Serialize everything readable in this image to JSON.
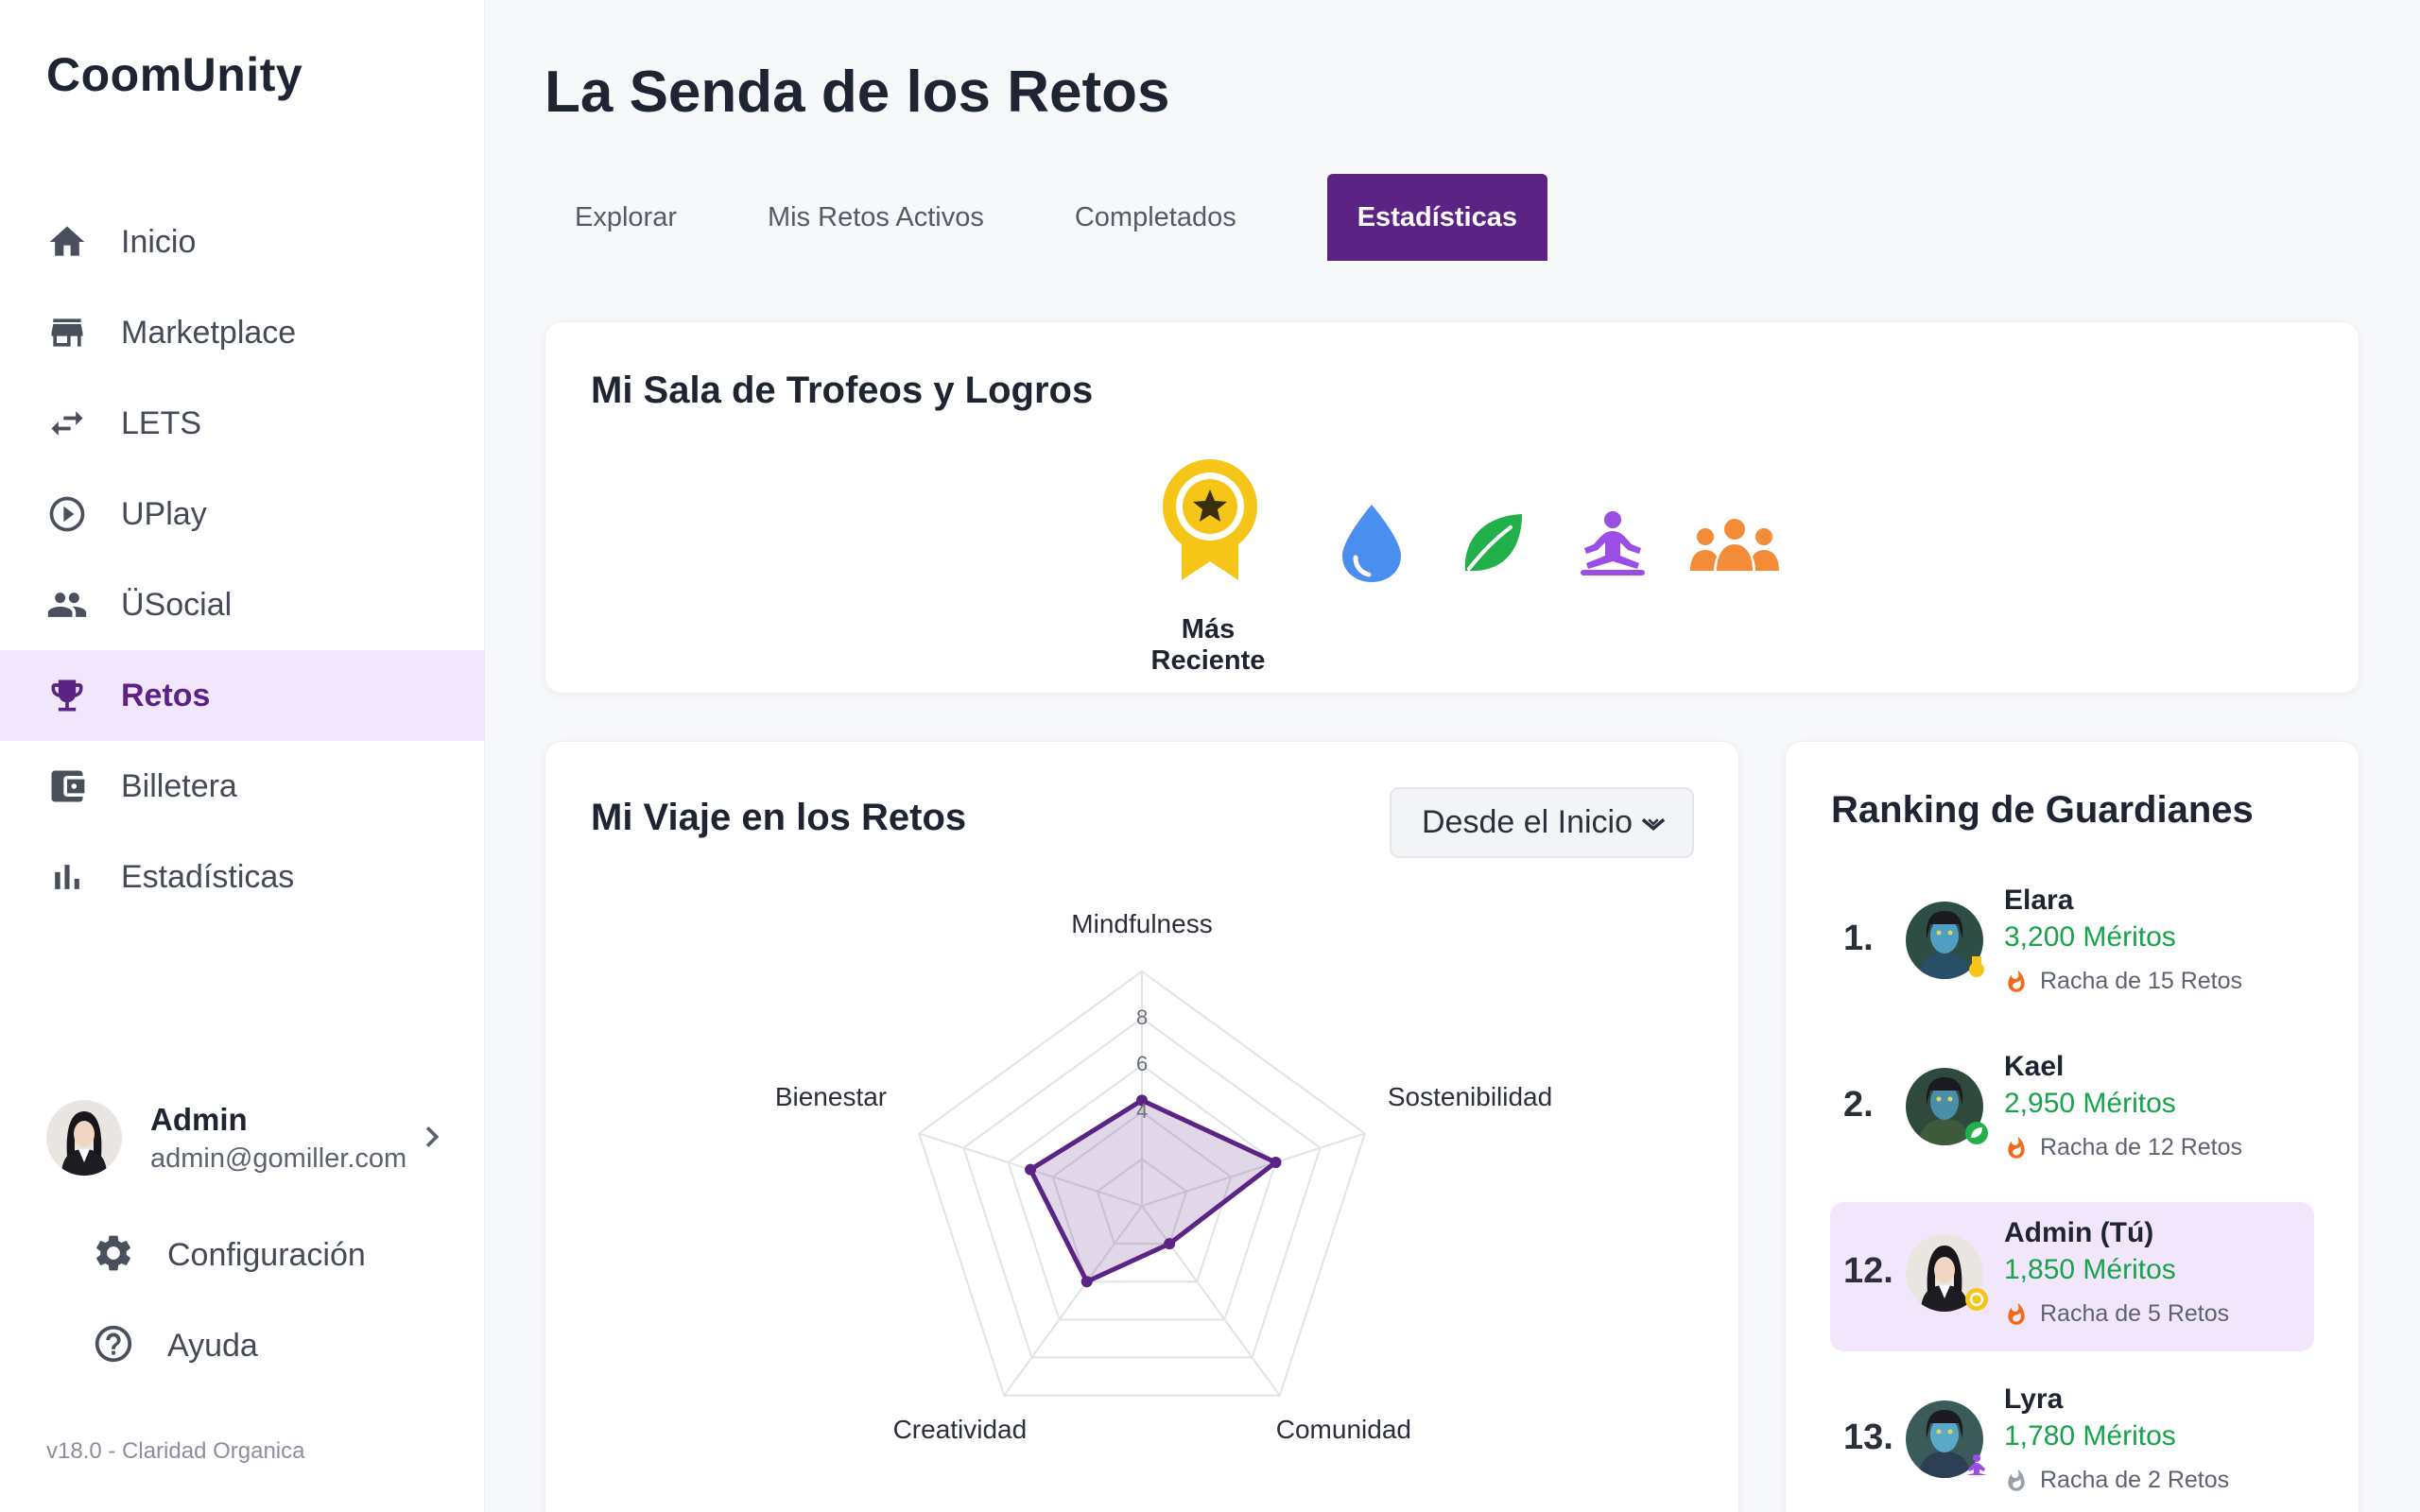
{
  "app": {
    "brand": "CoomUnity",
    "version": "v18.0 - Claridad Organica"
  },
  "sidebar": {
    "items": [
      {
        "label": "Inicio",
        "icon": "home-icon"
      },
      {
        "label": "Marketplace",
        "icon": "store-icon"
      },
      {
        "label": "LETS",
        "icon": "swap-arrows-icon"
      },
      {
        "label": "UPlay",
        "icon": "play-circle-icon"
      },
      {
        "label": "ÜSocial",
        "icon": "people-icon"
      },
      {
        "label": "Retos",
        "icon": "trophy-icon",
        "active": true
      },
      {
        "label": "Billetera",
        "icon": "wallet-icon"
      },
      {
        "label": "Estadísticas",
        "icon": "bar-chart-icon"
      }
    ],
    "profile": {
      "name": "Admin",
      "email": "admin@gomiller.com"
    },
    "settings_label": "Configuración",
    "help_label": "Ayuda"
  },
  "page": {
    "title": "La Senda de los Retos"
  },
  "tabs": [
    {
      "label": "Explorar"
    },
    {
      "label": "Mis Retos Activos"
    },
    {
      "label": "Completados"
    },
    {
      "label": "Estadísticas",
      "active": true
    }
  ],
  "trophies": {
    "title": "Mi Sala de Trofeos y Logros",
    "recent_label": "Más Reciente",
    "items": [
      {
        "icon": "medal-star-icon",
        "color": "#f5c518"
      },
      {
        "icon": "water-drop-icon",
        "color": "#4a8ef0"
      },
      {
        "icon": "leaf-icon",
        "color": "#22b04a"
      },
      {
        "icon": "meditation-icon",
        "color": "#9b4de6"
      },
      {
        "icon": "group-icon",
        "color": "#f28c38"
      }
    ]
  },
  "journey": {
    "title": "Mi Viaje en los Retos",
    "filter": "Desde el Inicio"
  },
  "chart_data": {
    "type": "radar",
    "categories": [
      "Mindfulness",
      "Sostenibilidad",
      "Comunidad",
      "Creatividad",
      "Bienestar"
    ],
    "series": [
      {
        "values": [
          4.5,
          6,
          2,
          4,
          5
        ]
      }
    ],
    "ticks": [
      "4",
      "6",
      "8"
    ],
    "rmax": 10,
    "color": "#5b2384"
  },
  "ranking": {
    "title": "Ranking de Guardianes",
    "items": [
      {
        "pos": "1.",
        "name": "Elara",
        "merits": "3,200 Méritos",
        "streak": "Racha de 15 Retos",
        "me": false,
        "badge_color": "#f5c518"
      },
      {
        "pos": "2.",
        "name": "Kael",
        "merits": "2,950 Méritos",
        "streak": "Racha de 12 Retos",
        "me": false,
        "badge_color": "#22b04a"
      },
      {
        "pos": "12.",
        "name": "Admin (Tú)",
        "merits": "1,850 Méritos",
        "streak": "Racha de 5 Retos",
        "me": true,
        "badge_color": "#f5c518"
      },
      {
        "pos": "13.",
        "name": "Lyra",
        "merits": "1,780 Méritos",
        "streak": "Racha de 2 Retos",
        "me": false,
        "badge_color": "#9b4de6"
      }
    ]
  }
}
